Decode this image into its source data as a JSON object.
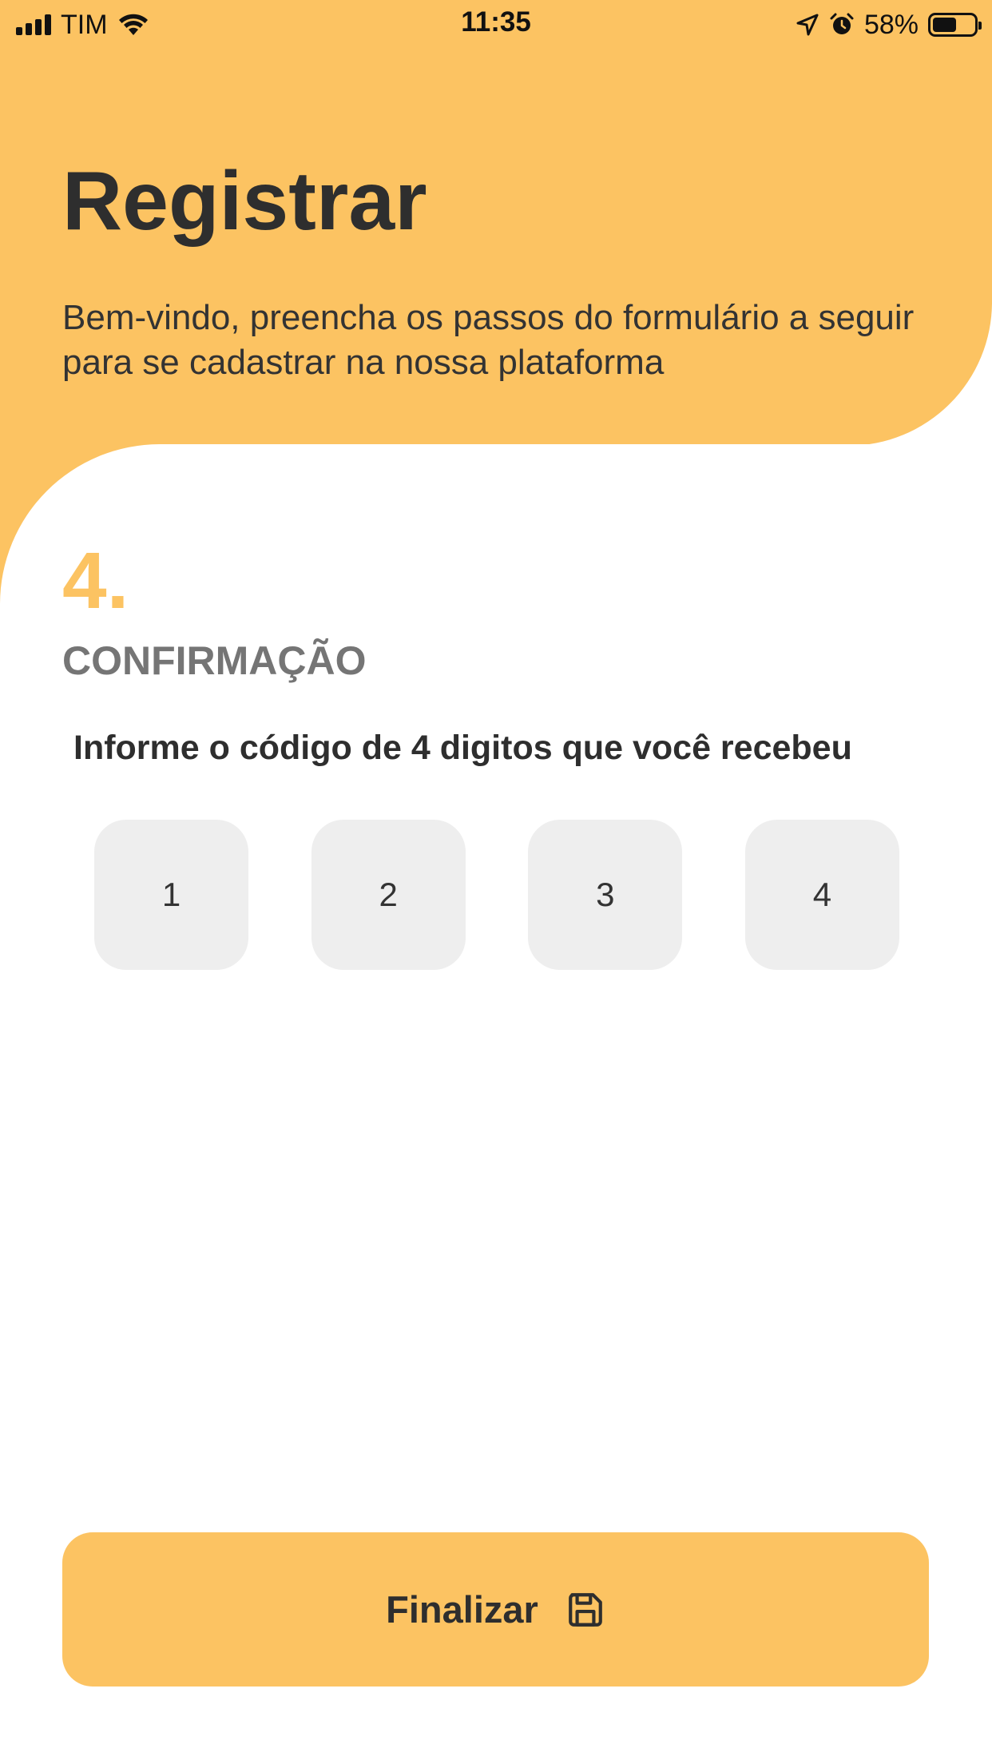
{
  "status_bar": {
    "carrier": "TIM",
    "time": "11:35",
    "battery": "58%",
    "battery_level": 0.58
  },
  "header": {
    "title": "Registrar",
    "subtitle": "Bem-vindo, preencha os passos do formulário a seguir para se cadastrar na nossa plataforma"
  },
  "step": {
    "number": "4.",
    "name": "CONFIRMAÇÃO",
    "instruction": "Informe o código de 4 digitos que você recebeu"
  },
  "code": {
    "digits": [
      "1",
      "2",
      "3",
      "4"
    ]
  },
  "actions": {
    "finish_label": "Finalizar",
    "finish_icon": "save-icon"
  },
  "colors": {
    "accent": "#fcc362",
    "input_bg": "#eeeeee",
    "text_dark": "#2e2e2e",
    "text_muted": "#757575"
  }
}
